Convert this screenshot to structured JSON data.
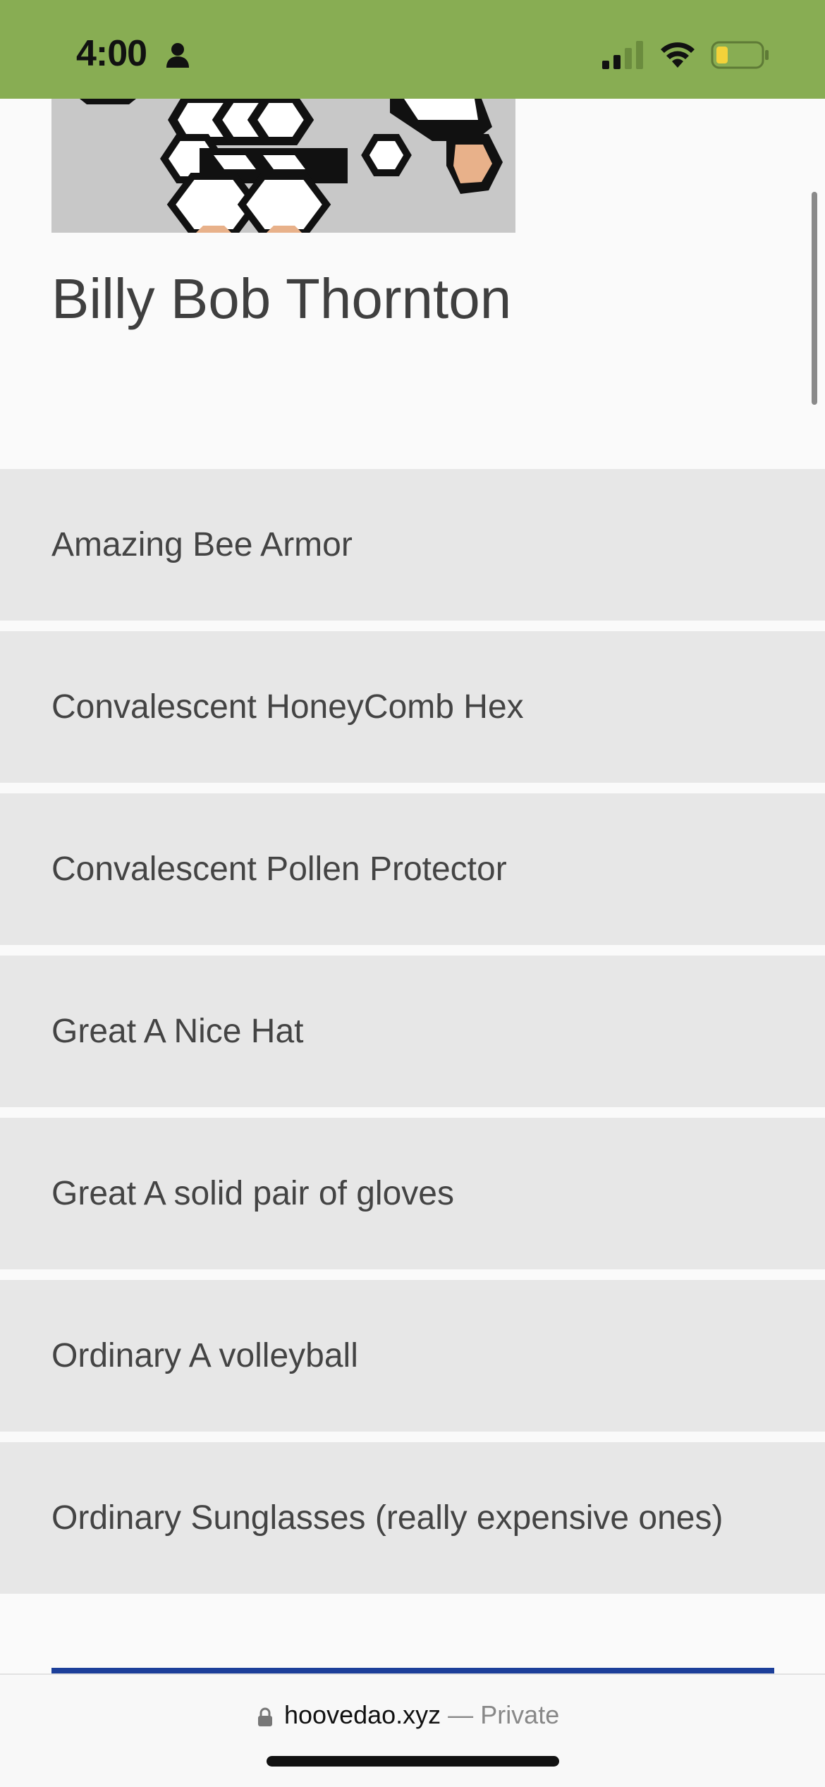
{
  "status_bar": {
    "time": "4:00",
    "background_color": "#88ad53",
    "icons": [
      "person-icon",
      "signal-icon",
      "wifi-icon",
      "battery-icon"
    ]
  },
  "player": {
    "name": "Billy Bob Thornton"
  },
  "items": [
    {
      "label": "Amazing Bee Armor"
    },
    {
      "label": "Convalescent HoneyComb Hex"
    },
    {
      "label": "Convalescent Pollen Protector"
    },
    {
      "label": "Great A Nice Hat"
    },
    {
      "label": "Great A solid pair of gloves"
    },
    {
      "label": "Ordinary A volleyball"
    },
    {
      "label": "Ordinary Sunglasses (really expensive ones)"
    }
  ],
  "url_bar": {
    "domain": "hoovedao.xyz",
    "separator": "—",
    "mode": "Private"
  },
  "colors": {
    "accent_bar": "#1c3f9a",
    "item_background": "#e7e7e7"
  }
}
